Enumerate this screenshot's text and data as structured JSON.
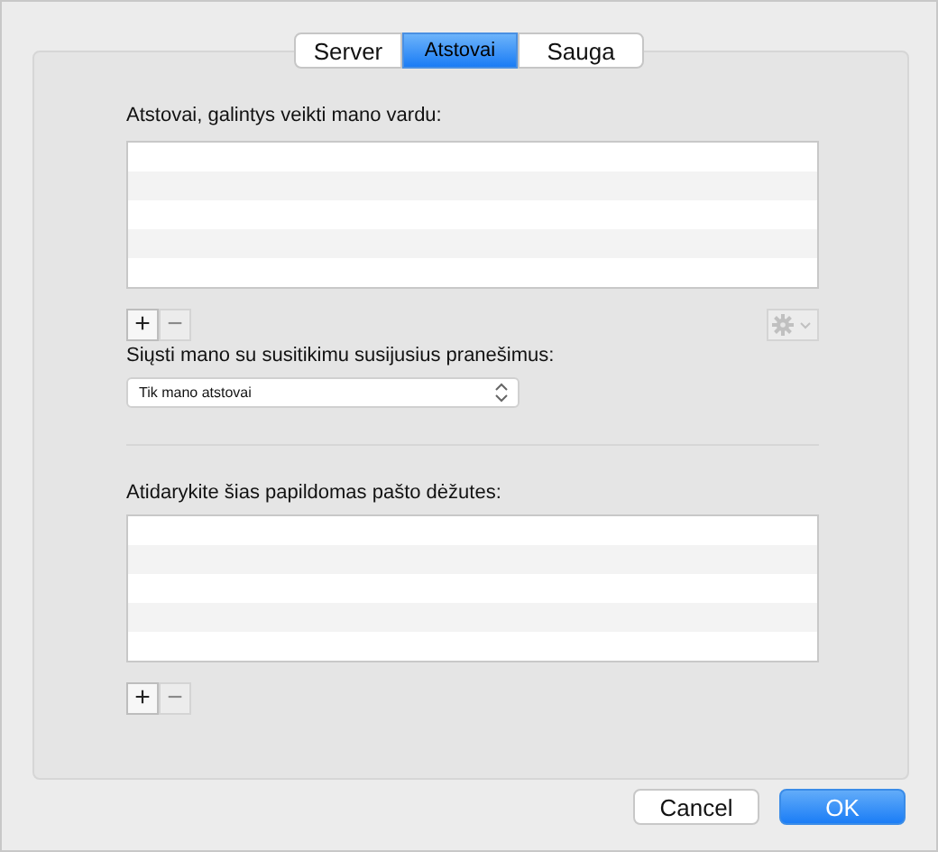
{
  "tabs": [
    {
      "label": "Server",
      "selected": false
    },
    {
      "label": "Atstovai",
      "selected": true
    },
    {
      "label": "Sauga",
      "selected": false
    }
  ],
  "delegates": {
    "label": "Atstovai, galintys veikti mano vardu:",
    "add": {
      "label": "+",
      "disabled": false
    },
    "remove": {
      "label": "−",
      "disabled": true
    },
    "settings": {
      "disabled": true
    }
  },
  "notifications": {
    "label": "Siųsti mano su susitikimu susijusius pranešimus:",
    "value": "Tik mano atstovai"
  },
  "mailboxes": {
    "label": "Atidarykite šias papildomas pašto dėžutes:",
    "add": {
      "label": "+",
      "disabled": false
    },
    "remove": {
      "label": "−",
      "disabled": true
    }
  },
  "buttons": [
    {
      "label": "Cancel",
      "kind": "secondary"
    },
    {
      "label": "OK",
      "kind": "primary"
    }
  ]
}
